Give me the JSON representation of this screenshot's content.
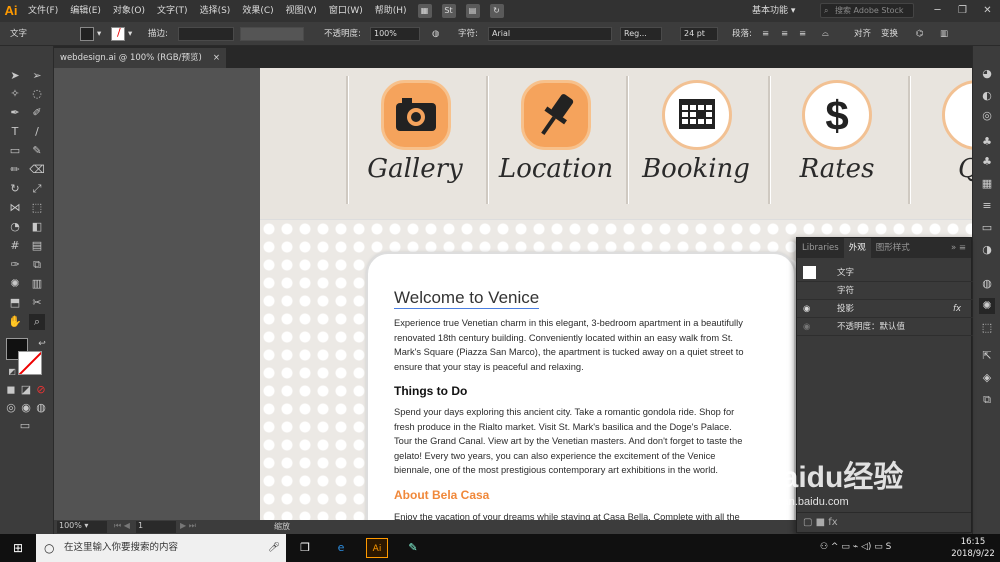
{
  "app": {
    "logo": "Ai"
  },
  "menubar": {
    "items": [
      "文件(F)",
      "编辑(E)",
      "对象(O)",
      "文字(T)",
      "选择(S)",
      "效果(C)",
      "视图(V)",
      "窗口(W)",
      "帮助(H)"
    ],
    "workspace_label": "基本功能",
    "search_placeholder": "搜索 Adobe Stock"
  },
  "control_bar": {
    "type_label": "文字",
    "stroke_label": "描边:",
    "opacity_label": "不透明度:",
    "opacity_value": "100%",
    "char_label": "字符:",
    "font_name": "Arial",
    "font_style": "Reg...",
    "font_size": "24 pt",
    "paragraph_label": "段落:",
    "align_label": "对齐",
    "transform_label": "变换"
  },
  "document": {
    "tab_title": "webdesign.ai @ 100% (RGB/预览)",
    "close_glyph": "×"
  },
  "banner": {
    "nav_items": [
      {
        "label": "Gallery",
        "icon": "camera-icon"
      },
      {
        "label": "Location",
        "icon": "pushpin-icon"
      },
      {
        "label": "Booking",
        "icon": "calendar-icon"
      },
      {
        "label": "Rates",
        "icon": "dollar-icon"
      },
      {
        "label": "Qu",
        "icon": "question-icon"
      }
    ]
  },
  "content": {
    "title": "Welcome to Venice",
    "intro_lines": [
      "Experience true Venetian charm in this elegant, 3-bedroom apartment in a beautifully",
      "renovated 18th century building. Conveniently located within an easy walk from St.",
      "Mark's Square (Piazza San Marco), the apartment is tucked away on a quiet street to",
      "ensure that your stay is peaceful and relaxing."
    ],
    "things_heading": "Things to Do",
    "things_lines": [
      "Spend your days exploring this ancient city. Take a romantic gondola ride. Shop for",
      "fresh produce in the Rialto market. Visit St. Mark's basilica and the Doge's Palace.",
      "Tour the Grand Canal. View art by the Venetian masters. And don't forget to taste the",
      "gelato! Every two years, you can also experience the excitement of the Venice",
      "biennale, one of the most prestigious contemporary art exhibitions in the world."
    ],
    "about_heading": "About Bela Casa",
    "about_line": "Enjoy the vacation of your dreams while staying at Casa Bella. Complete with all the"
  },
  "appearance_panel": {
    "tabs": [
      "Libraries",
      "外观",
      "图形样式"
    ],
    "active_tab": "外观",
    "rows": [
      {
        "label": "文字"
      },
      {
        "label": "字符"
      },
      {
        "label": "投影",
        "suffix": "fx"
      },
      {
        "label": "不透明度：默认值"
      }
    ]
  },
  "statusbar": {
    "zoom": "100%",
    "page": "1",
    "mode": "缩放"
  },
  "taskbar": {
    "search_placeholder": "在这里输入你要搜索的内容",
    "time": "16:15",
    "date": "2018/9/22"
  },
  "watermark": {
    "brand": "Baidu经验",
    "url": "jingyan.baidu.com"
  },
  "colors": {
    "accent_orange": "#f0883a",
    "ai_brand": "#ff9a00",
    "title_underline": "#4a7ee0"
  }
}
